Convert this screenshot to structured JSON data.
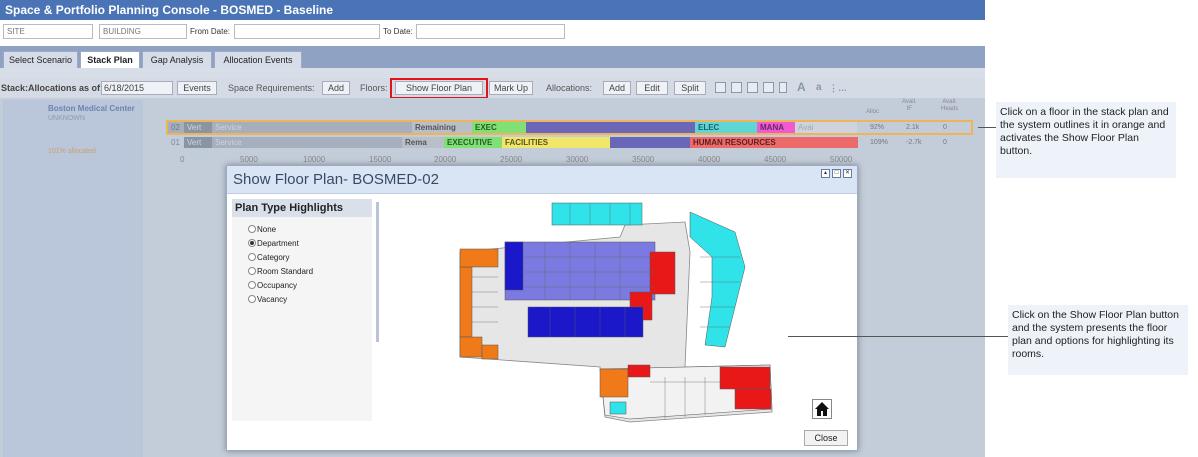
{
  "window_title": "Space & Portfolio Planning Console - BOSMED - Baseline",
  "filters": {
    "site_placeholder": "SITE",
    "building_placeholder": "BUILDING",
    "from_date_label": "From Date:",
    "to_date_label": "To Date:"
  },
  "tabs": [
    "Select Scenario",
    "Stack Plan",
    "Gap Analysis",
    "Allocation Events"
  ],
  "active_tab": "Stack Plan",
  "toolbar": {
    "stack_label": "Stack:Allocations as of:",
    "date_value": "6/18/2015",
    "events_btn": "Events",
    "space_req_label": "Space Requirements:",
    "add_btn": "Add",
    "floors_label": "Floors:",
    "show_floor_plan_btn": "Show Floor Plan",
    "mark_up_btn": "Mark Up",
    "allocations_label": "Allocations:",
    "alloc_add_btn": "Add",
    "edit_btn": "Edit",
    "split_btn": "Split"
  },
  "left_panel": {
    "building_name": "Boston Medical Center",
    "status": "UNKNOWN",
    "allocated": "101% allocated"
  },
  "stack_headers": {
    "alloc": "Alloc",
    "avail_sf_1": "Avail.",
    "avail_sf_2": "tF",
    "avail_heads_1": "Avail.",
    "avail_heads_2": "Heads"
  },
  "stack_rows": [
    {
      "floor": "02",
      "vert": "Vert",
      "service": "Service",
      "remaining": "Remaining",
      "segments": [
        "EXEC",
        "",
        "ELEC",
        "MANA",
        "Avai"
      ],
      "alloc": "92%",
      "avail_sf": "2.1k",
      "avail_heads": "0"
    },
    {
      "floor": "01",
      "vert": "Vert",
      "service": "Service",
      "remaining": "Rema",
      "segments": [
        "EXECUTIVE",
        "FACILITIES",
        "",
        "HUMAN RESOURCES",
        ""
      ],
      "alloc": "109%",
      "avail_sf": "-2.7k",
      "avail_heads": "0"
    }
  ],
  "axis_ticks": [
    "0",
    "5000",
    "10000",
    "15000",
    "20000",
    "25000",
    "30000",
    "35000",
    "40000",
    "45000",
    "50000"
  ],
  "dialog": {
    "title": "Show Floor Plan- BOSMED-02",
    "panel_title": "Plan Type Highlights",
    "options": [
      "None",
      "Department",
      "Category",
      "Room Standard",
      "Occupancy",
      "Vacancy"
    ],
    "selected_option": "Department",
    "close_btn": "Close"
  },
  "annotations": [
    "Click on a floor in the stack plan and the system outlines it in orange and activates the Show Floor Plan button.",
    "Click on the Show Floor Plan button and the system presents the floor plan and options for highlighting its rooms."
  ],
  "colors": {
    "title_bar": "#4b74b7",
    "exec": "#7fe073",
    "purple": "#6a66b8",
    "elec": "#5fd6d6",
    "mana": "#f05ad0",
    "facilities": "#f0e66a",
    "hr": "#ec6a6a",
    "highlight_red": "#e3131b",
    "row_select": "#f0b35a"
  }
}
